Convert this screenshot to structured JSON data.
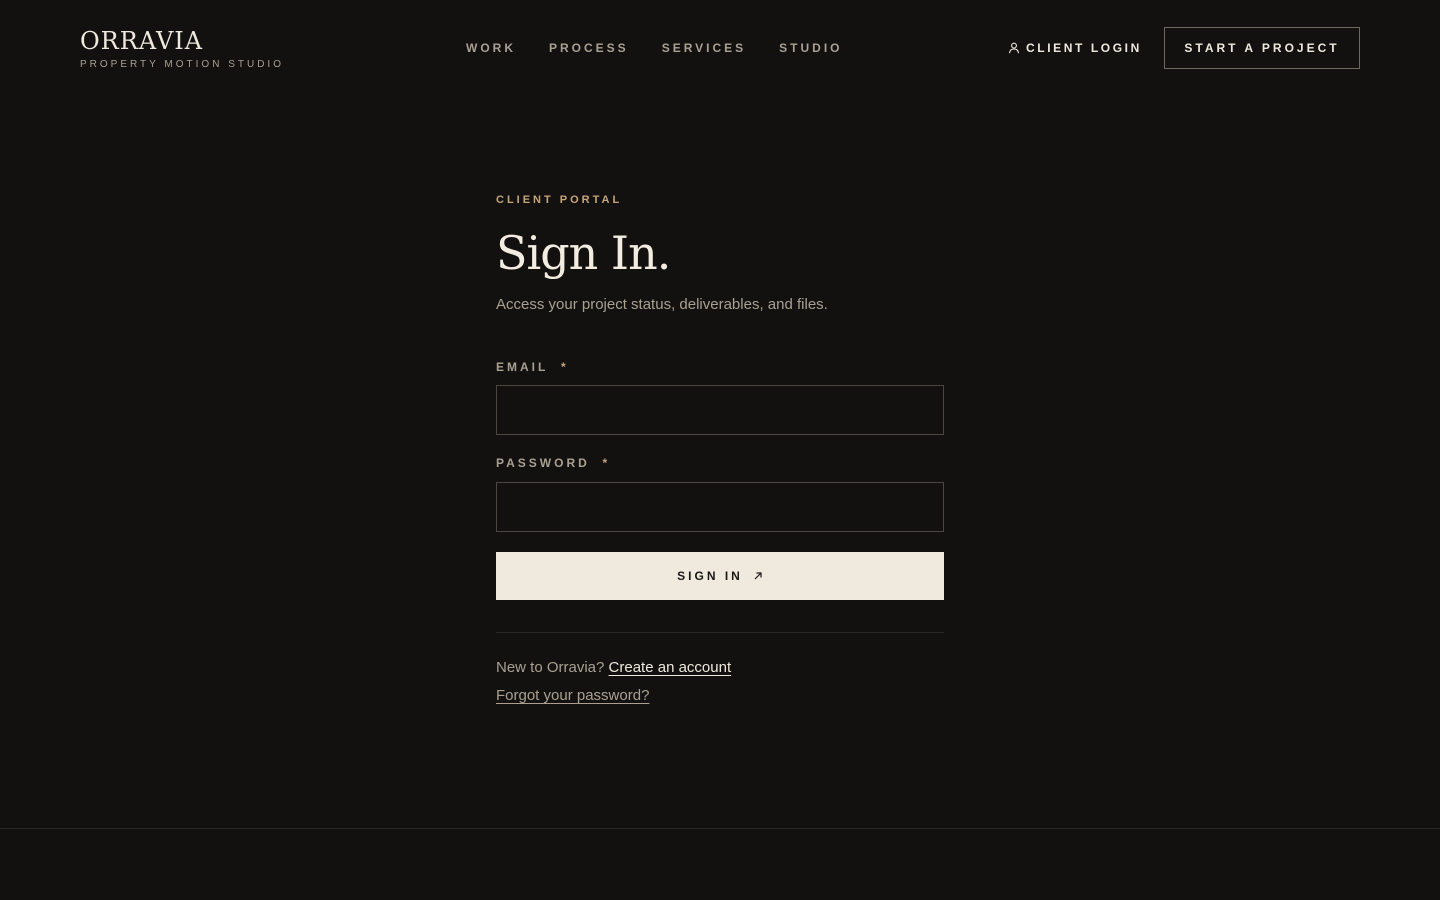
{
  "brand": {
    "name": "ORRAVIA",
    "tagline": "PROPERTY MOTION STUDIO"
  },
  "nav": {
    "items": [
      {
        "label": "WORK"
      },
      {
        "label": "PROCESS"
      },
      {
        "label": "SERVICES"
      },
      {
        "label": "STUDIO"
      }
    ],
    "client_login": "CLIENT LOGIN",
    "cta": "START A PROJECT"
  },
  "signin": {
    "eyebrow": "CLIENT PORTAL",
    "title": "Sign In.",
    "subtitle": "Access your project status, deliverables, and files.",
    "email_label": "EMAIL",
    "email_value": "",
    "password_label": "PASSWORD",
    "password_value": "",
    "required_marker": "*",
    "submit_label": "SIGN IN",
    "signup_prompt": "New to Orravia?",
    "signup_link": "Create an account",
    "forgot_link": "Forgot your password?"
  },
  "icons": {
    "client_login_icon": "user-icon",
    "submit_icon": "arrow-up-right-icon"
  },
  "colors": {
    "background": "#121110",
    "text": "#efe8dc",
    "muted": "#a9a092",
    "accent": "#c7a57a",
    "button_bg": "#f0e9dd"
  }
}
